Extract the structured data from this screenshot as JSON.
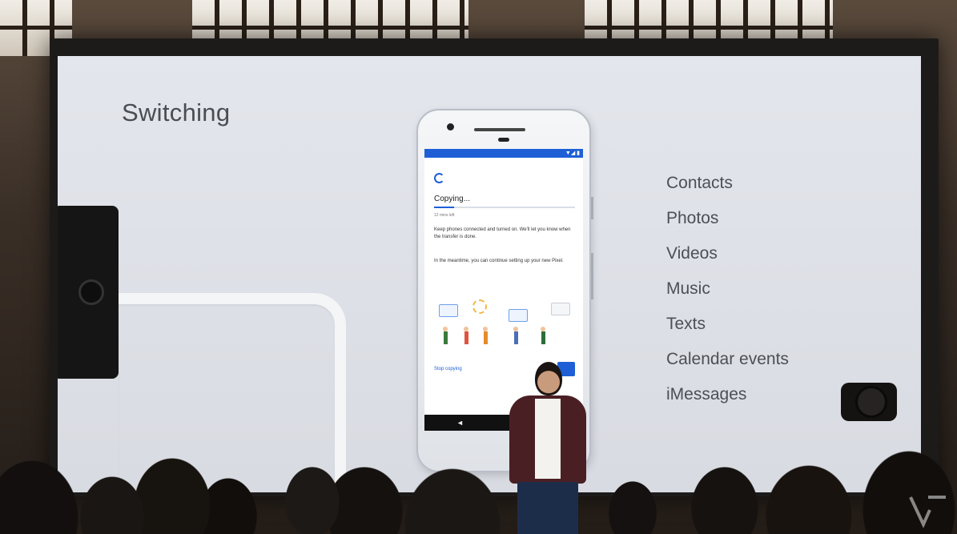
{
  "slide": {
    "title": "Switching",
    "content_types": [
      "Contacts",
      "Photos",
      "Videos",
      "Music",
      "Texts",
      "Calendar events",
      "iMessages"
    ]
  },
  "phone_screen": {
    "status_text": "▼◢ ▮",
    "heading": "Copying...",
    "progress_fraction": 0.14,
    "time_left": "12 mins left",
    "paragraph_1": "Keep phones connected and turned on. We'll let you know when the transfer is done.",
    "paragraph_2": "In the meantime, you can continue setting up your new Pixel.",
    "stop_copying": "Stop copying",
    "back_glyph": "◄",
    "accent_color": "#1e5fd6"
  },
  "icons": {
    "sync": "sync-icon",
    "camera": "camera-icon",
    "watermark": "verge-logo"
  }
}
